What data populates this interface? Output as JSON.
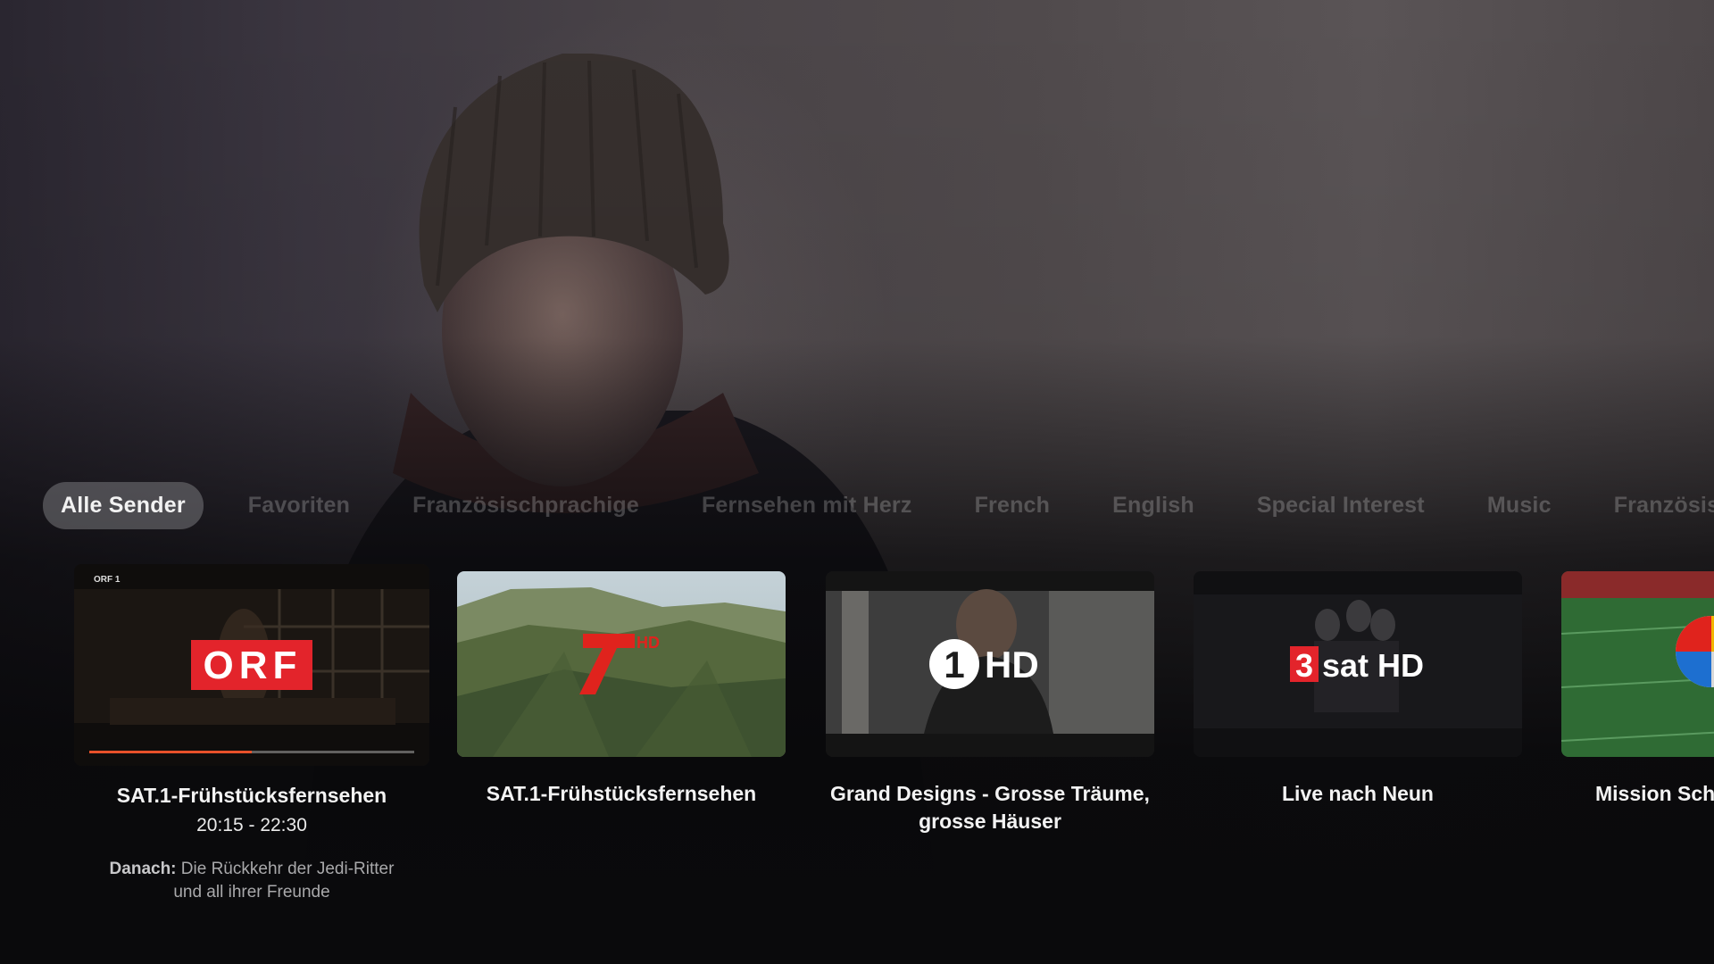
{
  "tabs": [
    {
      "label": "Alle Sender",
      "active": true
    },
    {
      "label": "Favoriten",
      "active": false
    },
    {
      "label": "Französischprachige",
      "active": false
    },
    {
      "label": "Fernsehen mit Herz",
      "active": false
    },
    {
      "label": "French",
      "active": false
    },
    {
      "label": "English",
      "active": false
    },
    {
      "label": "Special Interest",
      "active": false
    },
    {
      "label": "Music",
      "active": false
    },
    {
      "label": "Französischprach",
      "active": false
    }
  ],
  "channels": [
    {
      "logo": "ORF",
      "bug": "ORF 1",
      "title": "SAT.1-Frühstücksfernsehen",
      "time": "20:15 - 22:30",
      "next_label": "Danach:",
      "next_title": "Die Rückkehr der Jedi-Ritter und all ihrer Freunde",
      "progress": 0.5
    },
    {
      "logo": "HD",
      "title": "SAT.1-Frühstücksfernsehen"
    },
    {
      "logo": "HD",
      "logo_num": "1",
      "title": "Grand Designs - Grosse Träume, grosse Häuser"
    },
    {
      "logo": "sat HD",
      "logo_num": "3",
      "title": "Live nach Neun"
    },
    {
      "title": "Mission Sch"
    }
  ],
  "colors": {
    "accent": "#e8512a",
    "orf_red": "#e3242b",
    "pro7_red": "#e0231d"
  }
}
